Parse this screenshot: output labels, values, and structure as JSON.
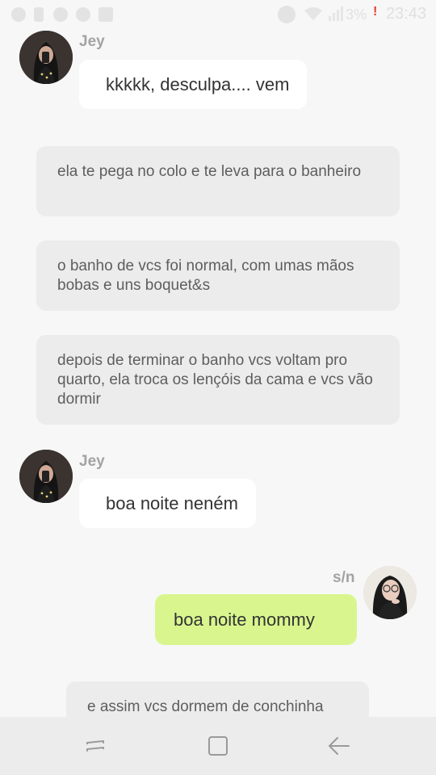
{
  "status_bar": {
    "battery": "3%",
    "time": "23:43",
    "alert": "!"
  },
  "messages": [
    {
      "sender": "Jey",
      "text": "kkkkk, desculpa.... vem"
    },
    {
      "sender": "Jey",
      "text": "boa noite neném"
    },
    {
      "sender": "s/n",
      "text": "boa noite mommy"
    }
  ],
  "narrations": [
    "ela te pega no colo e te leva para o banheiro",
    "o banho de vcs foi normal, com umas mãos bobas e uns boquet&s",
    "depois de terminar o banho vcs voltam pro quarto, ela troca os lençóis da cama e vcs vão dormir",
    "e assim vcs dormem de conchinha"
  ],
  "navbar": {
    "icons": [
      "recent-apps-icon",
      "home-icon",
      "back-icon"
    ]
  },
  "colors": {
    "background": "#f7f7f7",
    "outgoing_bubble": "#d9f68e",
    "incoming_bubble": "#ffffff",
    "narration_bubble": "#ececec"
  }
}
